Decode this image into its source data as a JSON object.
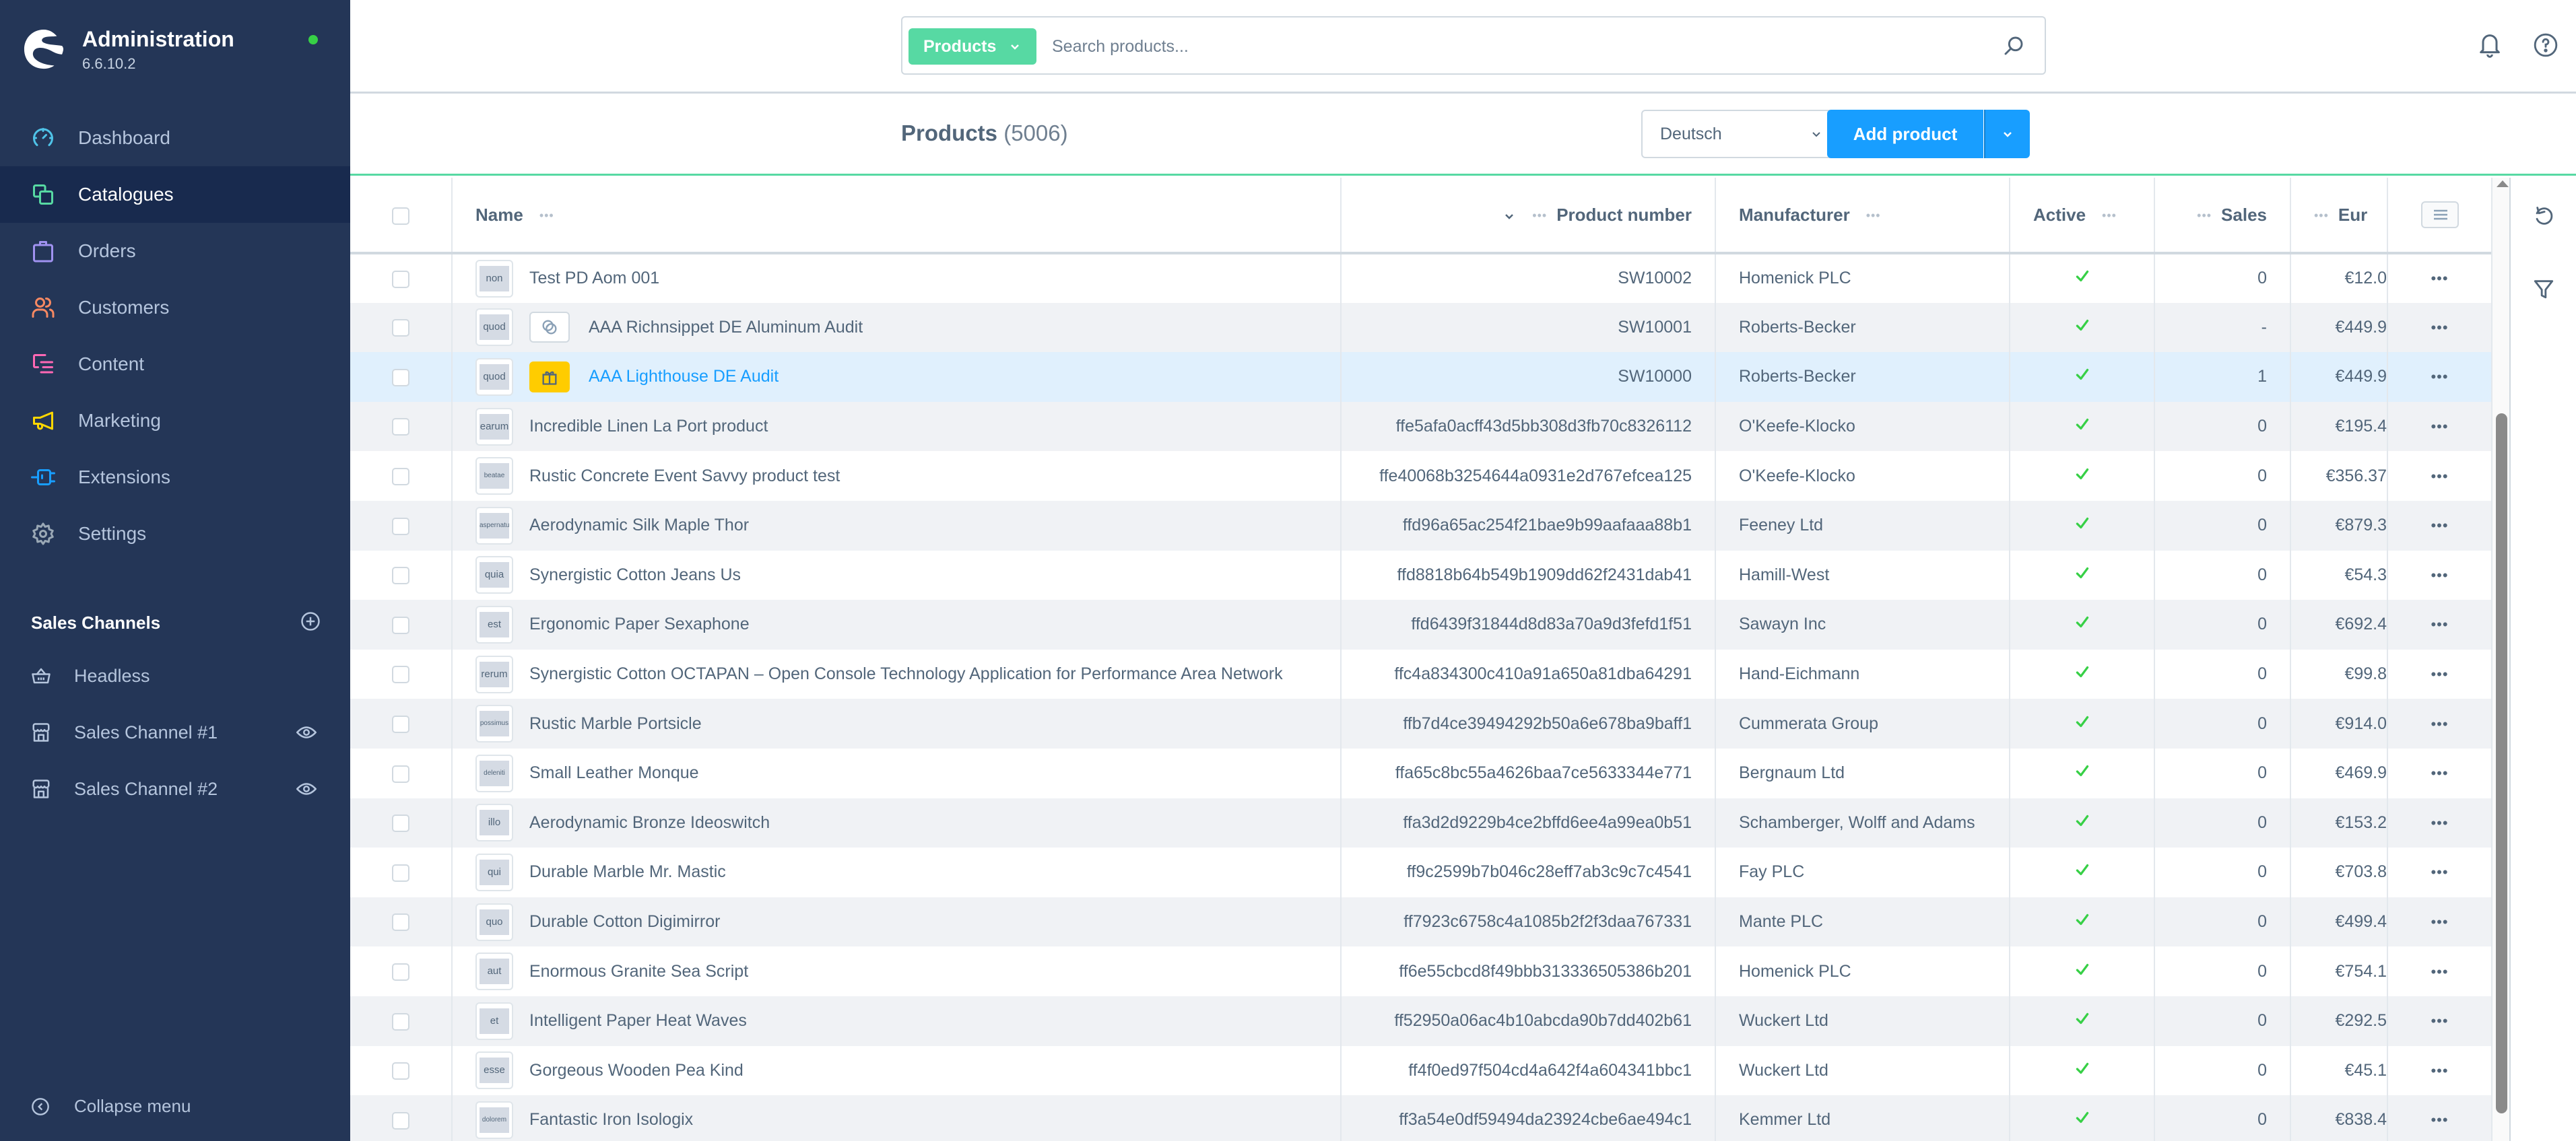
{
  "app": {
    "title": "Administration",
    "version": "6.6.10.2",
    "status_color": "#37d046"
  },
  "sidebar": {
    "items": [
      {
        "label": "Dashboard",
        "icon": "gauge-icon",
        "color": "#4fc3e8",
        "active": false
      },
      {
        "label": "Catalogues",
        "icon": "catalogue-icon",
        "color": "#57d9a3",
        "active": true
      },
      {
        "label": "Orders",
        "icon": "shopping-bag-icon",
        "color": "#a092f0",
        "active": false
      },
      {
        "label": "Customers",
        "icon": "users-icon",
        "color": "#f88962",
        "active": false
      },
      {
        "label": "Content",
        "icon": "content-icon",
        "color": "#ff68b4",
        "active": false
      },
      {
        "label": "Marketing",
        "icon": "megaphone-icon",
        "color": "#ffd700",
        "active": false
      },
      {
        "label": "Extensions",
        "icon": "plug-icon",
        "color": "#189eff",
        "active": false
      },
      {
        "label": "Settings",
        "icon": "gear-icon",
        "color": "#9aa8b5",
        "active": false
      }
    ],
    "sales_channels": {
      "title": "Sales Channels",
      "items": [
        {
          "label": "Headless",
          "icon": "basket-icon",
          "visible_toggle": false
        },
        {
          "label": "Sales Channel #1",
          "icon": "storefront-icon",
          "visible_toggle": true
        },
        {
          "label": "Sales Channel #2",
          "icon": "storefront-icon",
          "visible_toggle": true
        }
      ]
    },
    "collapse_label": "Collapse menu"
  },
  "search": {
    "type_label": "Products",
    "placeholder": "Search products...",
    "value": ""
  },
  "smartbar": {
    "title": "Products",
    "count": "(5006)",
    "language": "Deutsch",
    "add_label": "Add product"
  },
  "grid": {
    "columns": [
      {
        "key": "name",
        "label": "Name"
      },
      {
        "key": "number",
        "label": "Product number"
      },
      {
        "key": "manufacturer",
        "label": "Manufacturer"
      },
      {
        "key": "active",
        "label": "Active"
      },
      {
        "key": "sales",
        "label": "Sales"
      },
      {
        "key": "price",
        "label": "Eur"
      }
    ],
    "rows": [
      {
        "thumb": "non",
        "type": null,
        "name": "Test PD Aom 001",
        "number": "SW10002",
        "manufacturer": "Homenick PLC",
        "active": true,
        "sales": "0",
        "price": "€12.0",
        "highlight": false
      },
      {
        "thumb": "quod",
        "type": "variant",
        "name": "AAA Richnsippet DE Aluminum Audit",
        "number": "SW10001",
        "manufacturer": "Roberts-Becker",
        "active": true,
        "sales": "-",
        "price": "€449.9",
        "highlight": false
      },
      {
        "thumb": "quod",
        "type": "bundle",
        "name": "AAA Lighthouse DE Audit",
        "number": "SW10000",
        "manufacturer": "Roberts-Becker",
        "active": true,
        "sales": "1",
        "price": "€449.9",
        "highlight": true
      },
      {
        "thumb": "earum",
        "type": null,
        "name": "Incredible Linen La Port product",
        "number": "ffe5afa0acff43d5bb308d3fb70c8326112",
        "manufacturer": "O'Keefe-Klocko",
        "active": true,
        "sales": "0",
        "price": "€195.4",
        "highlight": false
      },
      {
        "thumb": "beatae",
        "type": null,
        "name": "Rustic Concrete Event Savvy product test",
        "number": "ffe40068b3254644a0931e2d767efcea125",
        "manufacturer": "O'Keefe-Klocko",
        "active": true,
        "sales": "0",
        "price": "€356.37",
        "highlight": false
      },
      {
        "thumb": "aspernatur",
        "type": null,
        "name": "Aerodynamic Silk Maple Thor",
        "number": "ffd96a65ac254f21bae9b99aafaaa88b1",
        "manufacturer": "Feeney Ltd",
        "active": true,
        "sales": "0",
        "price": "€879.3",
        "highlight": false
      },
      {
        "thumb": "quia",
        "type": null,
        "name": "Synergistic Cotton Jeans Us",
        "number": "ffd8818b64b549b1909dd62f2431dab41",
        "manufacturer": "Hamill-West",
        "active": true,
        "sales": "0",
        "price": "€54.3",
        "highlight": false
      },
      {
        "thumb": "est",
        "type": null,
        "name": "Ergonomic Paper Sexaphone",
        "number": "ffd6439f31844d8d83a70a9d3fefd1f51",
        "manufacturer": "Sawayn Inc",
        "active": true,
        "sales": "0",
        "price": "€692.4",
        "highlight": false
      },
      {
        "thumb": "rerum",
        "type": null,
        "name": "Synergistic Cotton OCTAPAN – Open Console Technology Application for Performance Area Network",
        "number": "ffc4a834300c410a91a650a81dba64291",
        "manufacturer": "Hand-Eichmann",
        "active": true,
        "sales": "0",
        "price": "€99.8",
        "highlight": false
      },
      {
        "thumb": "possimus",
        "type": null,
        "name": "Rustic Marble Portsicle",
        "number": "ffb7d4ce39494292b50a6e678ba9baff1",
        "manufacturer": "Cummerata Group",
        "active": true,
        "sales": "0",
        "price": "€914.0",
        "highlight": false
      },
      {
        "thumb": "deleniti",
        "type": null,
        "name": "Small Leather Monque",
        "number": "ffa65c8bc55a4626baa7ce5633344e771",
        "manufacturer": "Bergnaum Ltd",
        "active": true,
        "sales": "0",
        "price": "€469.9",
        "highlight": false
      },
      {
        "thumb": "illo",
        "type": null,
        "name": "Aerodynamic Bronze Ideoswitch",
        "number": "ffa3d2d9229b4ce2bffd6ee4a99ea0b51",
        "manufacturer": "Schamberger, Wolff and Adams",
        "active": true,
        "sales": "0",
        "price": "€153.2",
        "highlight": false
      },
      {
        "thumb": "qui",
        "type": null,
        "name": "Durable Marble Mr. Mastic",
        "number": "ff9c2599b7b046c28eff7ab3c9c7c4541",
        "manufacturer": "Fay PLC",
        "active": true,
        "sales": "0",
        "price": "€703.8",
        "highlight": false
      },
      {
        "thumb": "quo",
        "type": null,
        "name": "Durable Cotton Digimirror",
        "number": "ff7923c6758c4a1085b2f2f3daa767331",
        "manufacturer": "Mante PLC",
        "active": true,
        "sales": "0",
        "price": "€499.4",
        "highlight": false
      },
      {
        "thumb": "aut",
        "type": null,
        "name": "Enormous Granite Sea Script",
        "number": "ff6e55cbcd8f49bbb313336505386b201",
        "manufacturer": "Homenick PLC",
        "active": true,
        "sales": "0",
        "price": "€754.1",
        "highlight": false
      },
      {
        "thumb": "et",
        "type": null,
        "name": "Intelligent Paper Heat Waves",
        "number": "ff52950a06ac4b10abcda90b7dd402b61",
        "manufacturer": "Wuckert Ltd",
        "active": true,
        "sales": "0",
        "price": "€292.5",
        "highlight": false
      },
      {
        "thumb": "esse",
        "type": null,
        "name": "Gorgeous Wooden Pea Kind",
        "number": "ff4f0ed97f504cd4a642f4a604341bbc1",
        "manufacturer": "Wuckert Ltd",
        "active": true,
        "sales": "0",
        "price": "€45.1",
        "highlight": false
      },
      {
        "thumb": "dolorem",
        "type": null,
        "name": "Fantastic Iron Isologix",
        "number": "ff3a54e0df59494da23924cbe6ae494c1",
        "manufacturer": "Kemmer Ltd",
        "active": true,
        "sales": "0",
        "price": "€838.4",
        "highlight": false
      }
    ]
  },
  "colors": {
    "sidebar_bg": "#243657",
    "sidebar_active_bg": "#182a4e",
    "accent_green": "#57d9a3",
    "primary_blue": "#189eff",
    "check_green": "#37d046",
    "bundle_yellow": "#ffcc00"
  }
}
